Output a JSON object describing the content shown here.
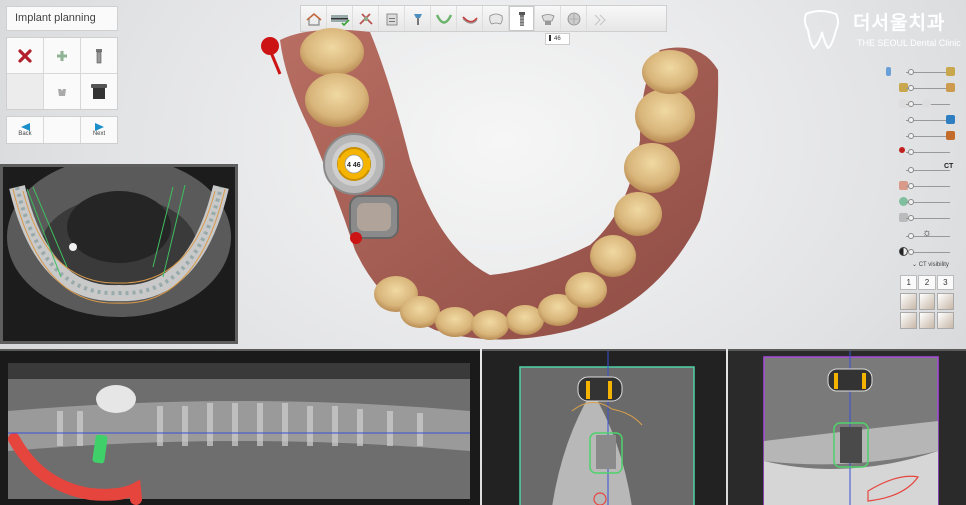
{
  "panel": {
    "title": "Implant planning"
  },
  "tools": [
    {
      "icon": "delete-x-icon",
      "color": "#b3202b"
    },
    {
      "icon": "add-plus-icon",
      "color": "#8fb393"
    },
    {
      "icon": "implant-icon",
      "color": "#555555"
    },
    {
      "icon": "blank-icon",
      "color": "#ececec"
    },
    {
      "icon": "abutment-icon",
      "color": "#999999"
    },
    {
      "icon": "sleeve-icon",
      "color": "#333333"
    }
  ],
  "navigation": {
    "back_label": "Back",
    "next_label": "Next",
    "arrow_color": "#1a8fc9"
  },
  "toolbar": {
    "buttons": [
      "home-icon",
      "scan-icon",
      "tools-icon",
      "clipboard-icon",
      "implant-guide-icon",
      "arch-icon",
      "curve-icon",
      "tooth-icon",
      "implant-icon",
      "crown-icon",
      "sphere-icon",
      "gray-tool-icon"
    ],
    "active_index": 8
  },
  "tooth_tag": {
    "label": "46"
  },
  "scene": {
    "implant_marker": "4 46",
    "marker_color": "#f4b400",
    "pin_color": "#cc1414"
  },
  "brand": {
    "korean": "더서울치과",
    "english": "THE SEOUL Dental Clinic"
  },
  "sliders": [
    {
      "icon": "implant-visibility-icon",
      "level": 0.1,
      "color": "#6aa0d8"
    },
    {
      "icon": "gold-abutment-icon",
      "level": 0.1,
      "color": "#c9a74c"
    },
    {
      "icon": "tooth-icon",
      "level": 0.1,
      "color": "#dddddd"
    },
    {
      "icon": "blue-marker-icon",
      "level": 0.1,
      "color": "#2f7ec2"
    },
    {
      "icon": "orange-marker-icon",
      "level": 0.1,
      "color": "#c26b2a"
    },
    {
      "icon": "pin-icon",
      "level": 0.1,
      "color": "#c02020"
    },
    {
      "icon": "ct-icon",
      "level": 0.1,
      "color": "#222222"
    },
    {
      "icon": "gum-icon",
      "level": 0.1,
      "color": "#d99a8a"
    },
    {
      "icon": "nerve-icon",
      "level": 0.1,
      "color": "#7fbf9f"
    },
    {
      "icon": "jaw-icon",
      "level": 0.1,
      "color": "#bbbbbb"
    },
    {
      "icon": "brightness-icon",
      "level": 0.4,
      "color": "#333333"
    },
    {
      "icon": "contrast-icon",
      "level": 0.1,
      "color": "#444444"
    }
  ],
  "ct": {
    "slider_label": "CT",
    "visibility_label": "CT visibility"
  },
  "view_tabs": [
    "1",
    "2",
    "3"
  ],
  "views": [
    "view-front-icon",
    "view-back-icon",
    "view-left-icon",
    "view-right-icon",
    "view-top-icon",
    "view-bottom-icon"
  ]
}
